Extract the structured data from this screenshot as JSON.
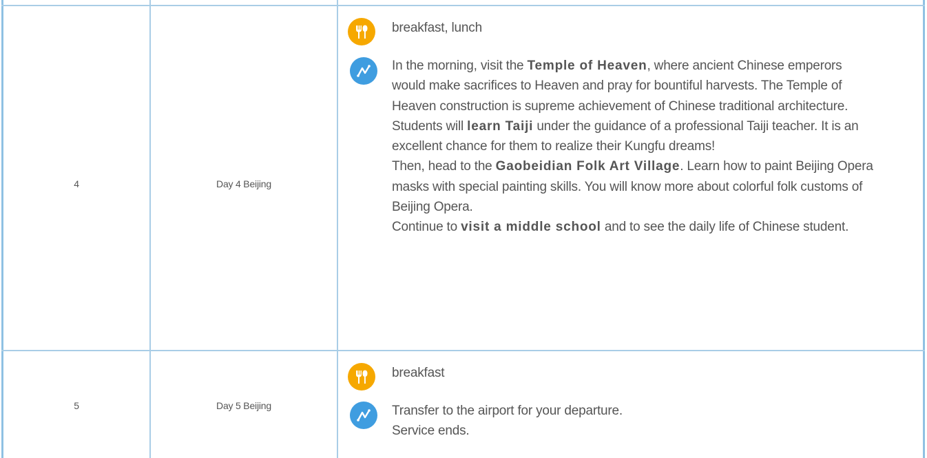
{
  "rows": [
    {
      "num": "4",
      "day": "Day 4 Beijing",
      "meals": "breakfast, lunch",
      "meal_icon": "meal-icon",
      "route_icon": "route-icon",
      "desc": {
        "p1_a": "In the morning, visit the ",
        "p1_b": "Temple of Heaven",
        "p1_c": ", where ancient Chinese emperors would make sacrifices to Heaven and pray for bountiful harvests. The Temple of Heaven construction is supreme achievement of Chinese traditional architecture.",
        "p2_a": "Students will ",
        "p2_b": "learn Taiji",
        "p2_c": " under the guidance of a professional Taiji teacher. It is an excellent chance for them to realize their Kungfu dreams!",
        "p3_a": "Then, head to the ",
        "p3_b": "Gaobeidian Folk Art Village",
        "p3_c": ". Learn how to paint Beijing Opera masks with special painting skills. You will know more about colorful folk customs of Beijing Opera.",
        "p4_a": "Continue to ",
        "p4_b": "visit a middle school",
        "p4_c": " and to see the daily life of Chinese student."
      }
    },
    {
      "num": "5",
      "day": "Day 5 Beijing",
      "meals": "breakfast",
      "meal_icon": "meal-icon",
      "route_icon": "route-icon",
      "desc": {
        "line1": "Transfer to the airport for your departure.",
        "line2": "Service ends."
      }
    }
  ],
  "colors": {
    "border": "#a9cde6",
    "meal_icon_bg": "#f6a800",
    "route_icon_bg": "#3f9de0",
    "text": "#555555"
  }
}
